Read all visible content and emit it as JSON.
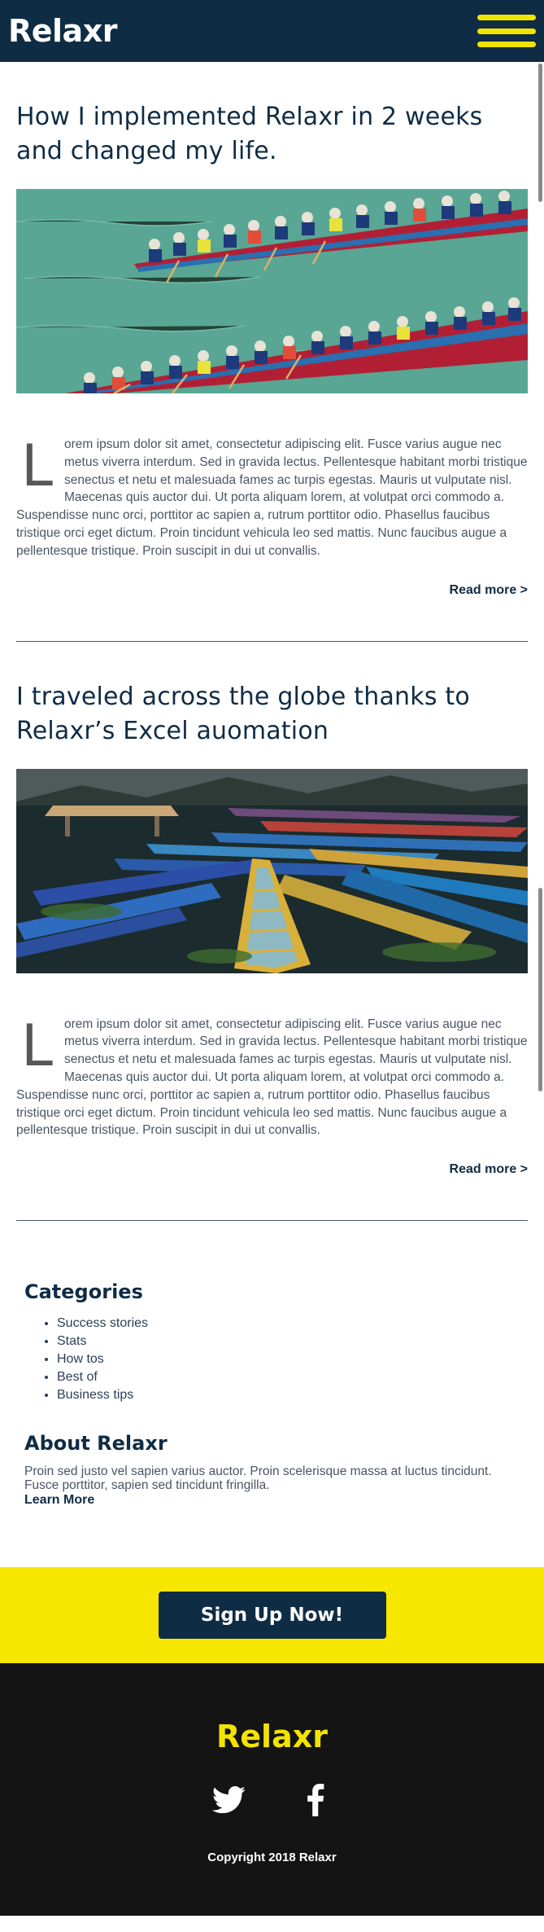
{
  "header": {
    "logo": "Relaxr",
    "menu_icon": "hamburger-menu-icon"
  },
  "posts": [
    {
      "title": "How I implemented Relaxr in 2 weeks and changed my life.",
      "image_icon": "dragon-boat-race-photo",
      "dropcap": "L",
      "body": "orem ipsum dolor sit amet, consectetur adipiscing elit. Fusce varius augue nec metus viverra interdum. Sed in gravida lectus. Pellentesque habitant morbi tristique senectus et netu et malesuada fames ac turpis egestas. Mauris ut vulputate nisl. Maecenas quis auctor dui. Ut porta aliquam lorem, at volutpat orci commodo a. Suspendisse nunc orci, porttitor ac sapien a, rutrum porttitor odio. Phasellus faucibus tristique orci eget dictum. Proin tincidunt vehicula leo sed mattis. Nunc faucibus augue a pellentesque tristique. Proin suscipit in dui ut convallis.",
      "read_more": "Read more >"
    },
    {
      "title": "I traveled across the globe thanks to Relaxr’s Excel auomation",
      "image_icon": "lake-rowboats-photo",
      "dropcap": "L",
      "body": "orem ipsum dolor sit amet, consectetur adipiscing elit. Fusce varius augue nec metus viverra interdum. Sed in gravida lectus. Pellentesque habitant morbi tristique senectus et netu et malesuada fames ac turpis egestas. Mauris ut vulputate nisl. Maecenas quis auctor dui. Ut porta aliquam lorem, at volutpat orci commodo a. Suspendisse nunc orci, porttitor ac sapien a, rutrum porttitor odio. Phasellus faucibus tristique orci eget dictum. Proin tincidunt vehicula leo sed mattis. Nunc faucibus augue a pellentesque tristique. Proin suscipit in dui ut convallis.",
      "read_more": "Read more >"
    }
  ],
  "categories": {
    "title": "Categories",
    "items": [
      "Success stories",
      "Stats",
      "How tos",
      "Best of",
      "Business tips"
    ]
  },
  "about": {
    "title": "About Relaxr",
    "text": "Proin sed justo vel sapien varius auctor. Proin scelerisque massa at luctus tincidunt. Fusce porttitor, sapien sed tincidunt fringilla.",
    "link": "Learn More"
  },
  "cta": {
    "button": "Sign Up Now!"
  },
  "footer": {
    "logo": "Relaxr",
    "socials": [
      "twitter-icon",
      "facebook-icon"
    ],
    "copyright": "Copyright 2018 Relaxr"
  },
  "colors": {
    "navy": "#0f2c45",
    "yellow": "#f3e400",
    "footer_bg": "#141414"
  }
}
